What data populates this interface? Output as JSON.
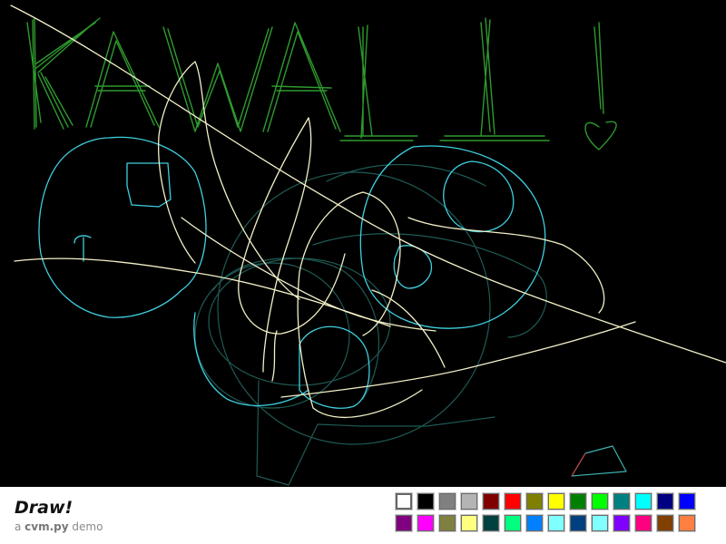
{
  "app": {
    "title": "Draw!",
    "subtitle_prefix": "a ",
    "subtitle_brand": "cvm.py",
    "subtitle_suffix": " demo"
  },
  "canvas": {
    "background": "#000000",
    "drawing_text": "KAWAII !"
  },
  "palette": {
    "selected": "#ffffff",
    "row1": [
      "#ffffff",
      "#000000",
      "#808080",
      "#b4b4b4",
      "#800000",
      "#ff0000",
      "#808000",
      "#ffff00",
      "#008000",
      "#00ff00",
      "#008080",
      "#00ffff",
      "#000080",
      "#0000ff"
    ],
    "row2": [
      "#800080",
      "#ff00ff",
      "#808040",
      "#ffff80",
      "#004040",
      "#00ff80",
      "#0080ff",
      "#80ffff",
      "#004080",
      "#80ffff",
      "#8000ff",
      "#ff0080",
      "#804000",
      "#ff8040"
    ]
  }
}
